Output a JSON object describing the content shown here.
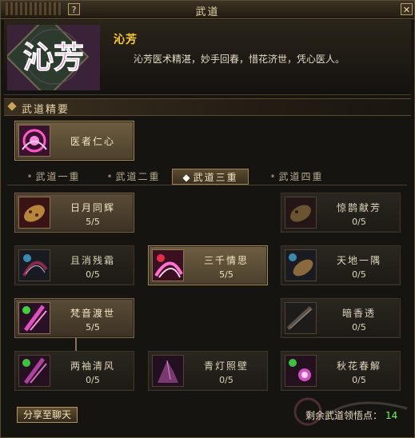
{
  "window": {
    "title": "武道",
    "help_label": "?",
    "close_label": "✕"
  },
  "hero": {
    "portrait_text": "沁芳",
    "name": "沁芳",
    "description": "沁芳医术精湛，妙手回春，惜花济世，凭心医人。"
  },
  "essence": {
    "section_title": "武道精要",
    "skill": {
      "name": "医者仁心",
      "icon": "pink-swirl-icon"
    }
  },
  "tabs": [
    {
      "label": "武道一重",
      "selected": false
    },
    {
      "label": "武道二重",
      "selected": false
    },
    {
      "label": "武道三重",
      "selected": true
    },
    {
      "label": "武道四重",
      "selected": false
    }
  ],
  "skills": [
    {
      "name": "日月同辉",
      "progress": "5/5",
      "icon": "golden-stone-icon",
      "state": "learned"
    },
    {
      "name": "惊鹊献芳",
      "progress": "0/5",
      "icon": "golden-stone-icon",
      "state": "locked"
    },
    {
      "name": "且消残霜",
      "progress": "0/5",
      "icon": "blue-dragon-icon",
      "state": "locked"
    },
    {
      "name": "三千情思",
      "progress": "5/5",
      "icon": "red-swirl-icon",
      "state": "active"
    },
    {
      "name": "天地一隅",
      "progress": "0/5",
      "icon": "golden-stone-icon",
      "state": "locked"
    },
    {
      "name": "梵音渡世",
      "progress": "5/5",
      "icon": "green-rune-icon",
      "state": "learned"
    },
    {
      "name": "暗香透",
      "progress": "0/5",
      "icon": "dark-blade-icon",
      "state": "locked"
    },
    {
      "name": "两袖清风",
      "progress": "0/5",
      "icon": "green-rune-icon",
      "state": "locked"
    },
    {
      "name": "青灯照壁",
      "progress": "0/5",
      "icon": "purple-crystal-icon",
      "state": "locked"
    },
    {
      "name": "秋花春解",
      "progress": "0/5",
      "icon": "green-sparkle-icon",
      "state": "locked"
    }
  ],
  "footer": {
    "share_label": "分享至聊天",
    "points_label": "剩余武道领悟点：",
    "points_value": "14"
  },
  "colors": {
    "gold_text": "#ffcc33",
    "points_green": "#66ff44",
    "panel_bg": "#161411"
  }
}
